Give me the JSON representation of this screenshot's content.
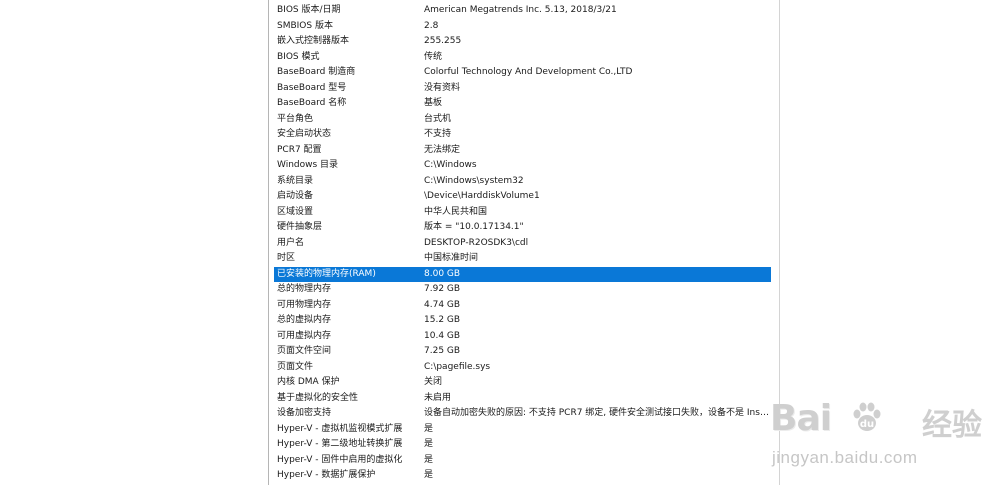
{
  "rows": [
    {
      "item": "BIOS 版本/日期",
      "value": "American Megatrends Inc. 5.13, 2018/3/21"
    },
    {
      "item": "SMBIOS 版本",
      "value": "2.8"
    },
    {
      "item": "嵌入式控制器版本",
      "value": "255.255"
    },
    {
      "item": "BIOS 模式",
      "value": "传统"
    },
    {
      "item": "BaseBoard 制造商",
      "value": "Colorful Technology And Development Co.,LTD"
    },
    {
      "item": "BaseBoard 型号",
      "value": "没有资料"
    },
    {
      "item": "BaseBoard 名称",
      "value": "基板"
    },
    {
      "item": "平台角色",
      "value": "台式机"
    },
    {
      "item": "安全启动状态",
      "value": "不支持"
    },
    {
      "item": "PCR7 配置",
      "value": "无法绑定"
    },
    {
      "item": "Windows 目录",
      "value": "C:\\Windows"
    },
    {
      "item": "系统目录",
      "value": "C:\\Windows\\system32"
    },
    {
      "item": "启动设备",
      "value": "\\Device\\HarddiskVolume1"
    },
    {
      "item": "区域设置",
      "value": "中华人民共和国"
    },
    {
      "item": "硬件抽象层",
      "value": "版本 = \"10.0.17134.1\""
    },
    {
      "item": "用户名",
      "value": "DESKTOP-R2OSDK3\\cdl"
    },
    {
      "item": "时区",
      "value": "中国标准时间"
    },
    {
      "item": "已安装的物理内存(RAM)",
      "value": "8.00 GB",
      "selected": true
    },
    {
      "item": "总的物理内存",
      "value": "7.92 GB"
    },
    {
      "item": "可用物理内存",
      "value": "4.74 GB"
    },
    {
      "item": "总的虚拟内存",
      "value": "15.2 GB"
    },
    {
      "item": "可用虚拟内存",
      "value": "10.4 GB"
    },
    {
      "item": "页面文件空间",
      "value": "7.25 GB"
    },
    {
      "item": "页面文件",
      "value": "C:\\pagefile.sys"
    },
    {
      "item": "内核 DMA 保护",
      "value": "关闭"
    },
    {
      "item": "基于虚拟化的安全性",
      "value": "未启用"
    },
    {
      "item": "设备加密支持",
      "value": "设备自动加密失败的原因: 不支持 PCR7 绑定, 硬件安全测试接口失败，设备不是 Inst..."
    },
    {
      "item": "Hyper-V - 虚拟机监视模式扩展",
      "value": "是"
    },
    {
      "item": "Hyper-V - 第二级地址转换扩展",
      "value": "是"
    },
    {
      "item": "Hyper-V - 固件中启用的虚拟化",
      "value": "是"
    },
    {
      "item": "Hyper-V - 数据扩展保护",
      "value": "是"
    }
  ],
  "watermark": {
    "logo_left": "Bai",
    "logo_right": "经验",
    "url": "jingyan.baidu.com"
  },
  "colors": {
    "selection": "#0a78d7",
    "background": "#ffffff",
    "text": "#1a1a1a"
  }
}
